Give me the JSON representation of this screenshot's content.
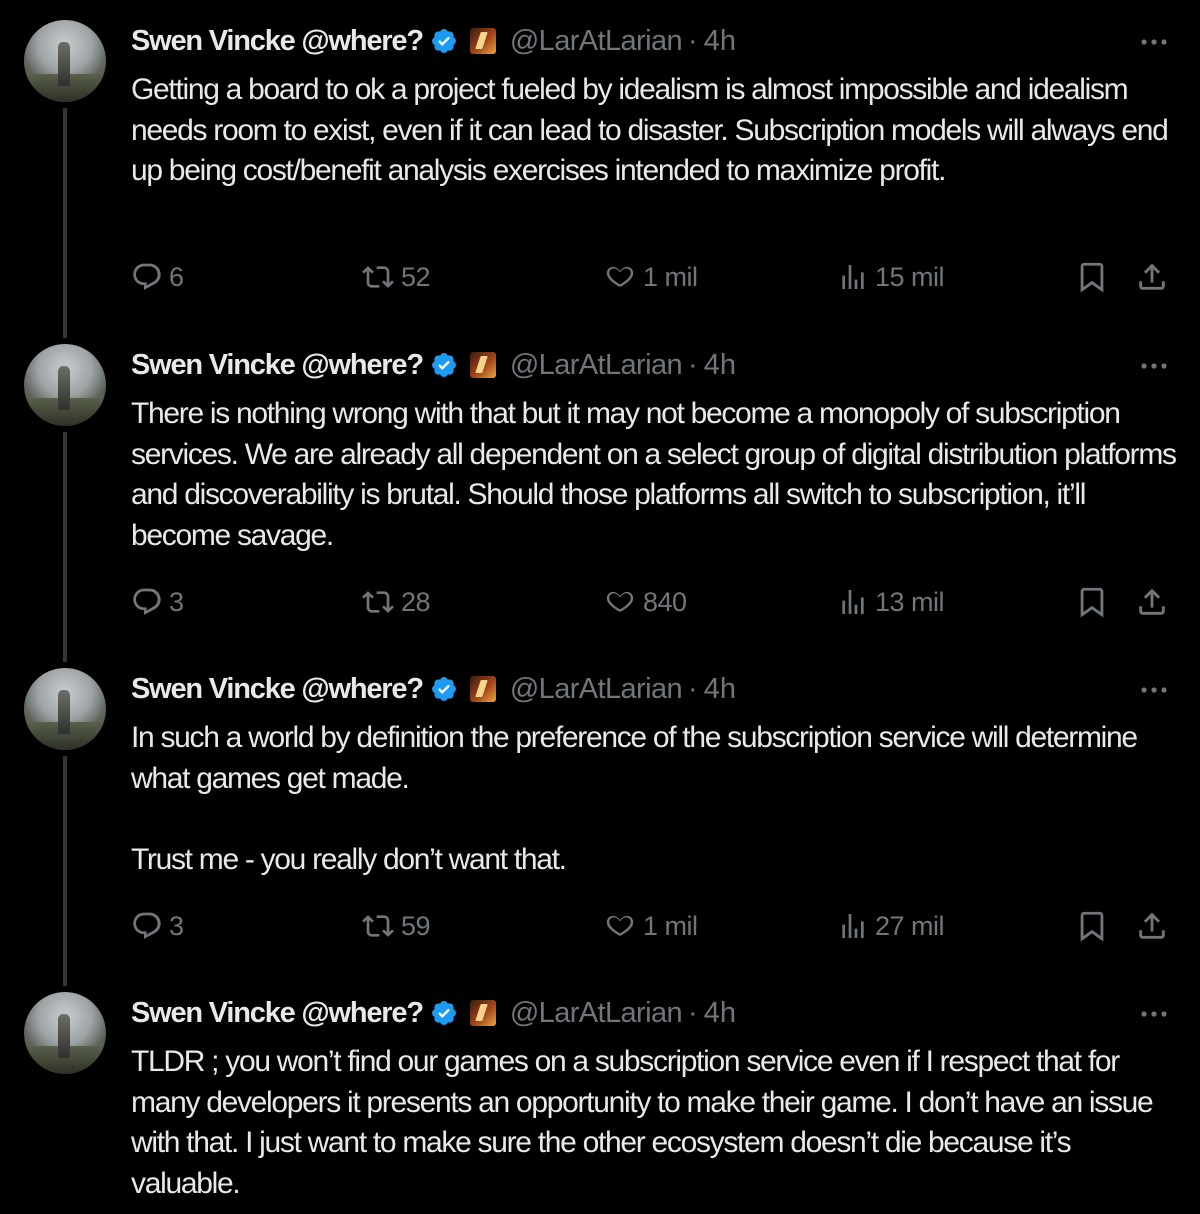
{
  "tweets": [
    {
      "name": "Swen Vincke @where?",
      "handle": "@LarAtLarian",
      "separator": "·",
      "time": "4h",
      "text": "Getting a board to ok a project fueled by idealism is almost impossible and idealism needs room to exist, even if it can lead to disaster. Subscription models will always end up being cost/benefit analysis exercises intended to maximize profit.",
      "replies": "6",
      "reposts": "52",
      "likes": "1 mil",
      "views": "15 mil"
    },
    {
      "name": "Swen Vincke @where?",
      "handle": "@LarAtLarian",
      "separator": "·",
      "time": "4h",
      "text": "There is nothing wrong with that but it may not become a monopoly of subscription services. We are already all dependent on a select group of digital distribution platforms and discoverability is brutal. Should those platforms all switch to subscription, it’ll become savage.",
      "replies": "3",
      "reposts": "28",
      "likes": "840",
      "views": "13 mil"
    },
    {
      "name": "Swen Vincke @where?",
      "handle": "@LarAtLarian",
      "separator": "·",
      "time": "4h",
      "text": "In such a world by definition the preference of the subscription service will determine what games get made.\n\nTrust me - you really don’t want that.",
      "replies": "3",
      "reposts": "59",
      "likes": "1 mil",
      "views": "27 mil"
    },
    {
      "name": "Swen Vincke @where?",
      "handle": "@LarAtLarian",
      "separator": "·",
      "time": "4h",
      "text": "TLDR ; you won’t find our games on a subscription service even if I respect that for many developers it presents an opportunity to make their game. I don’t have an issue with that. I just want to make sure the other ecosystem doesn’t die because it’s valuable."
    }
  ],
  "icons": {
    "verified": "verified-badge-icon",
    "brand": "larian-affiliate-badge-icon",
    "more": "more-options-icon",
    "reply": "reply-icon",
    "repost": "repost-icon",
    "like": "heart-icon",
    "views": "views-icon",
    "bookmark": "bookmark-icon",
    "share": "share-icon"
  },
  "colors": {
    "background": "#000000",
    "text": "#e7e9ea",
    "muted": "#71767b",
    "verified": "#1d9bf0",
    "thread_line": "#333639"
  }
}
